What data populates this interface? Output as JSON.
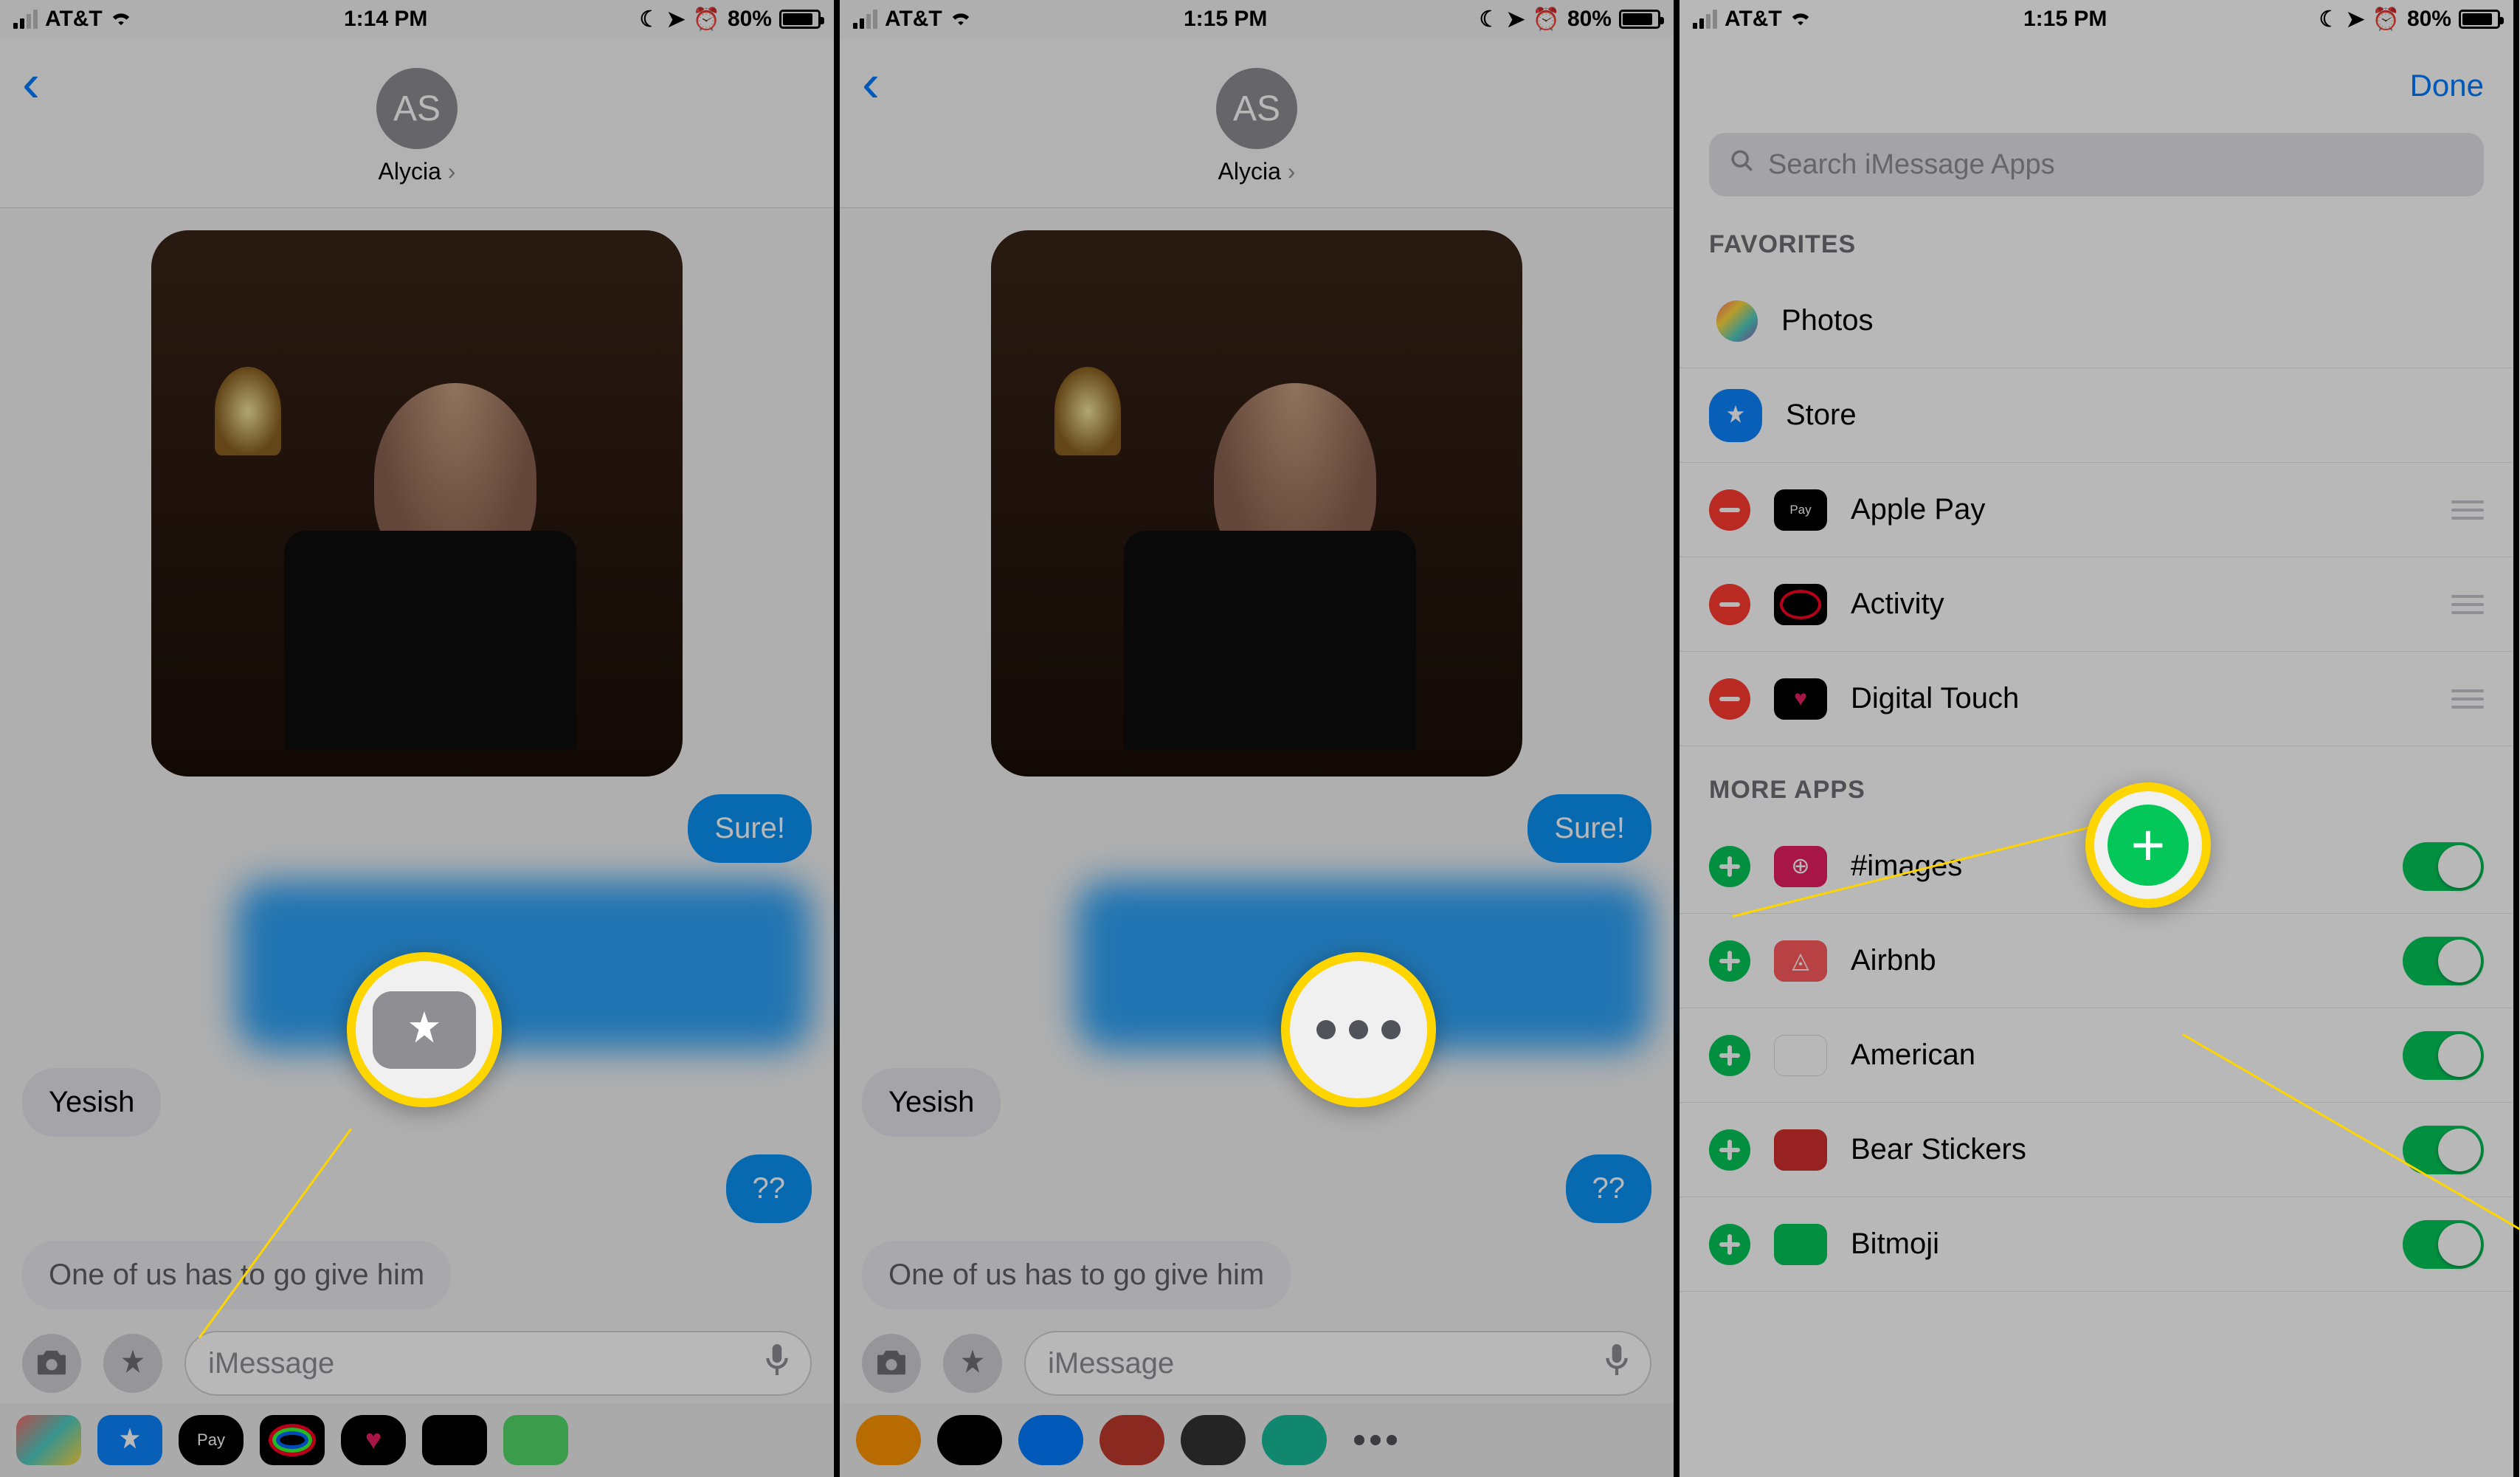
{
  "status": {
    "carrier": "AT&T",
    "time1": "1:14 PM",
    "time2": "1:15 PM",
    "time3": "1:15 PM",
    "battery": "80%"
  },
  "chat": {
    "avatar_initials": "AS",
    "contact_name": "Alycia",
    "msg_sure": "Sure!",
    "msg_yesish": "Yesish",
    "msg_qq": "??",
    "draft_preview": "One of us has to go give him",
    "input_placeholder": "iMessage"
  },
  "screen3": {
    "done": "Done",
    "search_placeholder": "Search iMessage Apps",
    "favorites_header": "FAVORITES",
    "more_header": "MORE APPS",
    "fav_photos": "Photos",
    "fav_store": "Store",
    "fav_applepay": "Apple Pay",
    "fav_activity": "Activity",
    "fav_digital": "Digital Touch",
    "app_images": "#images",
    "app_airbnb": "Airbnb",
    "app_american": "American",
    "app_bear": "Bear Stickers",
    "app_bitmoji": "Bitmoji"
  }
}
